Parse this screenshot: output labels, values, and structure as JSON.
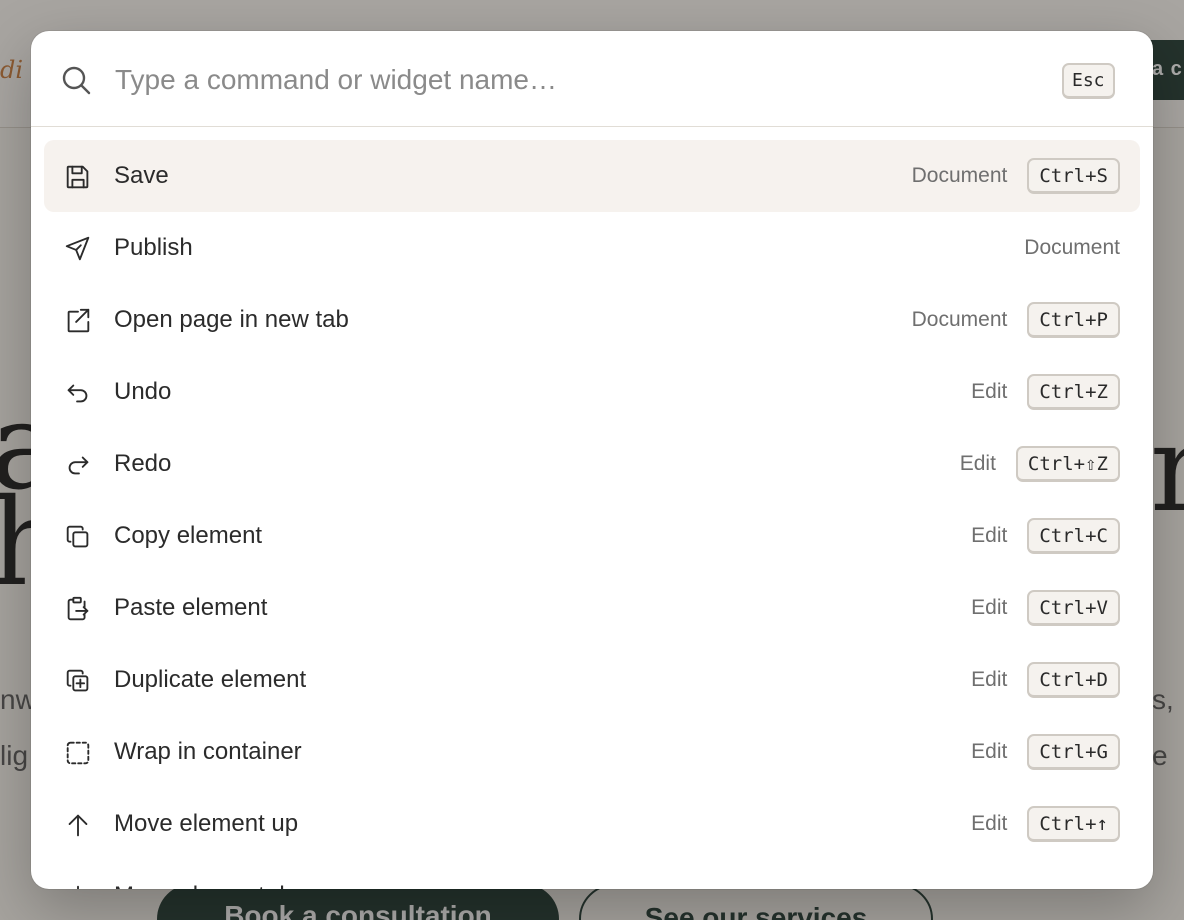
{
  "background": {
    "brand_text": "di",
    "top_cta_text": "a c",
    "hero_left": "a\nh",
    "hero_right": "r",
    "body_left": "nw\nlig",
    "body_right": "s,\ne",
    "primary_button": "Book a consultation",
    "secondary_button": "See our services"
  },
  "palette": {
    "search": {
      "placeholder": "Type a command or widget name…",
      "value": "",
      "esc_label": "Esc",
      "icon": "search-icon"
    },
    "items": [
      {
        "label": "Save",
        "category": "Document",
        "shortcut": "Ctrl+S",
        "icon": "save-icon",
        "active": true
      },
      {
        "label": "Publish",
        "category": "Document",
        "shortcut": "",
        "icon": "send-icon",
        "active": false
      },
      {
        "label": "Open page in new tab",
        "category": "Document",
        "shortcut": "Ctrl+P",
        "icon": "external-link-icon",
        "active": false
      },
      {
        "label": "Undo",
        "category": "Edit",
        "shortcut": "Ctrl+Z",
        "icon": "undo-icon",
        "active": false
      },
      {
        "label": "Redo",
        "category": "Edit",
        "shortcut": "Ctrl+⇧Z",
        "icon": "redo-icon",
        "active": false
      },
      {
        "label": "Copy element",
        "category": "Edit",
        "shortcut": "Ctrl+C",
        "icon": "copy-icon",
        "active": false
      },
      {
        "label": "Paste element",
        "category": "Edit",
        "shortcut": "Ctrl+V",
        "icon": "paste-icon",
        "active": false
      },
      {
        "label": "Duplicate element",
        "category": "Edit",
        "shortcut": "Ctrl+D",
        "icon": "duplicate-icon",
        "active": false
      },
      {
        "label": "Wrap in container",
        "category": "Edit",
        "shortcut": "Ctrl+G",
        "icon": "container-icon",
        "active": false
      },
      {
        "label": "Move element up",
        "category": "Edit",
        "shortcut": "Ctrl+↑",
        "icon": "arrow-up-icon",
        "active": false
      },
      {
        "label": "Move element down",
        "category": "",
        "shortcut": "",
        "icon": "arrow-down-icon",
        "active": false
      }
    ]
  },
  "colors": {
    "active_row": "#f6f2ee",
    "dark_accent": "#233a33",
    "brand_accent": "#c97b3c"
  }
}
